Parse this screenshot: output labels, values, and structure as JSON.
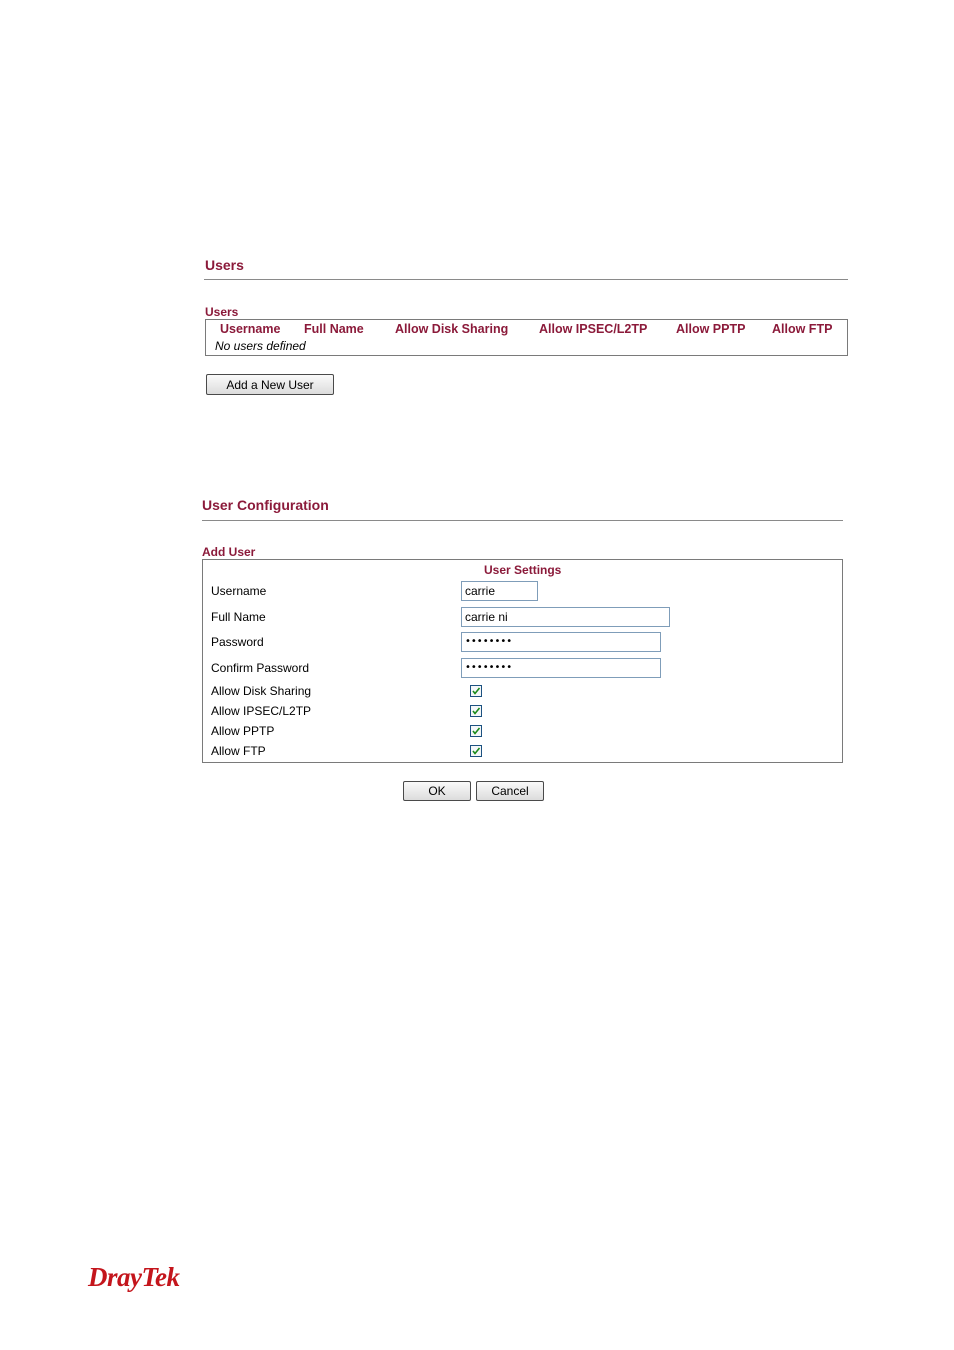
{
  "users_panel": {
    "title": "Users",
    "table_caption": "Users",
    "columns": [
      "Username",
      "Full Name",
      "Allow Disk Sharing",
      "Allow IPSEC/L2TP",
      "Allow PPTP",
      "Allow FTP"
    ],
    "empty_message": "No users defined",
    "add_button": "Add a New User"
  },
  "config_panel": {
    "title": "User Configuration",
    "form_caption": "Add User",
    "settings_header": "User Settings",
    "fields": {
      "username": {
        "label": "Username",
        "value": "carrie"
      },
      "full_name": {
        "label": "Full Name",
        "value": "carrie ni"
      },
      "password": {
        "label": "Password",
        "value": "••••••••"
      },
      "confirm_password": {
        "label": "Confirm Password",
        "value": "••••••••"
      }
    },
    "checkboxes": [
      {
        "label": "Allow Disk Sharing",
        "checked": true
      },
      {
        "label": "Allow IPSEC/L2TP",
        "checked": true
      },
      {
        "label": "Allow PPTP",
        "checked": true
      },
      {
        "label": "Allow FTP",
        "checked": true
      }
    ],
    "ok_button": "OK",
    "cancel_button": "Cancel"
  },
  "brand": {
    "logo_text": "DrayTek",
    "accent_color": "#8b1a3a",
    "logo_color": "#c4151c"
  }
}
